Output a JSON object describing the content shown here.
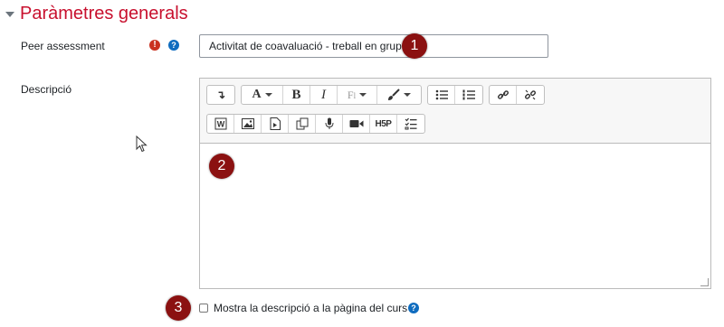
{
  "section": {
    "title": "Paràmetres generals"
  },
  "name_field": {
    "label": "Peer assessment",
    "value": "Activitat de coavaluació - treball en grup",
    "required_icon": "exclamation-icon",
    "help_icon": "question-icon"
  },
  "description_field": {
    "label": "Descripció",
    "toolbar_row1": [
      {
        "name": "toggle-toolbar-icon",
        "glyph": "↴"
      },
      {
        "name": "font-color-icon",
        "glyph": "A"
      },
      {
        "name": "bold-icon",
        "glyph": "B"
      },
      {
        "name": "italic-icon",
        "glyph": "I"
      },
      {
        "name": "paragraph-style-icon",
        "glyph": "Fl"
      },
      {
        "name": "brush-icon",
        "glyph": "✎"
      },
      {
        "name": "unordered-list-icon",
        "glyph": "☰"
      },
      {
        "name": "ordered-list-icon",
        "glyph": "☷"
      },
      {
        "name": "link-icon",
        "glyph": "🔗"
      },
      {
        "name": "unlink-icon",
        "glyph": "⛓"
      }
    ],
    "toolbar_row2": [
      {
        "name": "word-import-icon",
        "glyph": "W"
      },
      {
        "name": "image-icon",
        "glyph": "▣"
      },
      {
        "name": "media-icon",
        "glyph": "▦"
      },
      {
        "name": "manage-files-icon",
        "glyph": "⧉"
      },
      {
        "name": "microphone-icon",
        "glyph": "🎙"
      },
      {
        "name": "video-camera-icon",
        "glyph": "■"
      },
      {
        "name": "h5p-icon",
        "glyph": "H5P"
      },
      {
        "name": "checklist-icon",
        "glyph": "☑"
      }
    ]
  },
  "show_description": {
    "label": "Mostra la descripció a la pàgina del curs",
    "checked": false,
    "help_icon": "question-icon"
  },
  "callouts": {
    "one": "1",
    "two": "2",
    "three": "3"
  },
  "colors": {
    "section_title": "#c8102e",
    "callout": "#8b1111",
    "required": "#ca3120",
    "help": "#0f6cbf"
  }
}
